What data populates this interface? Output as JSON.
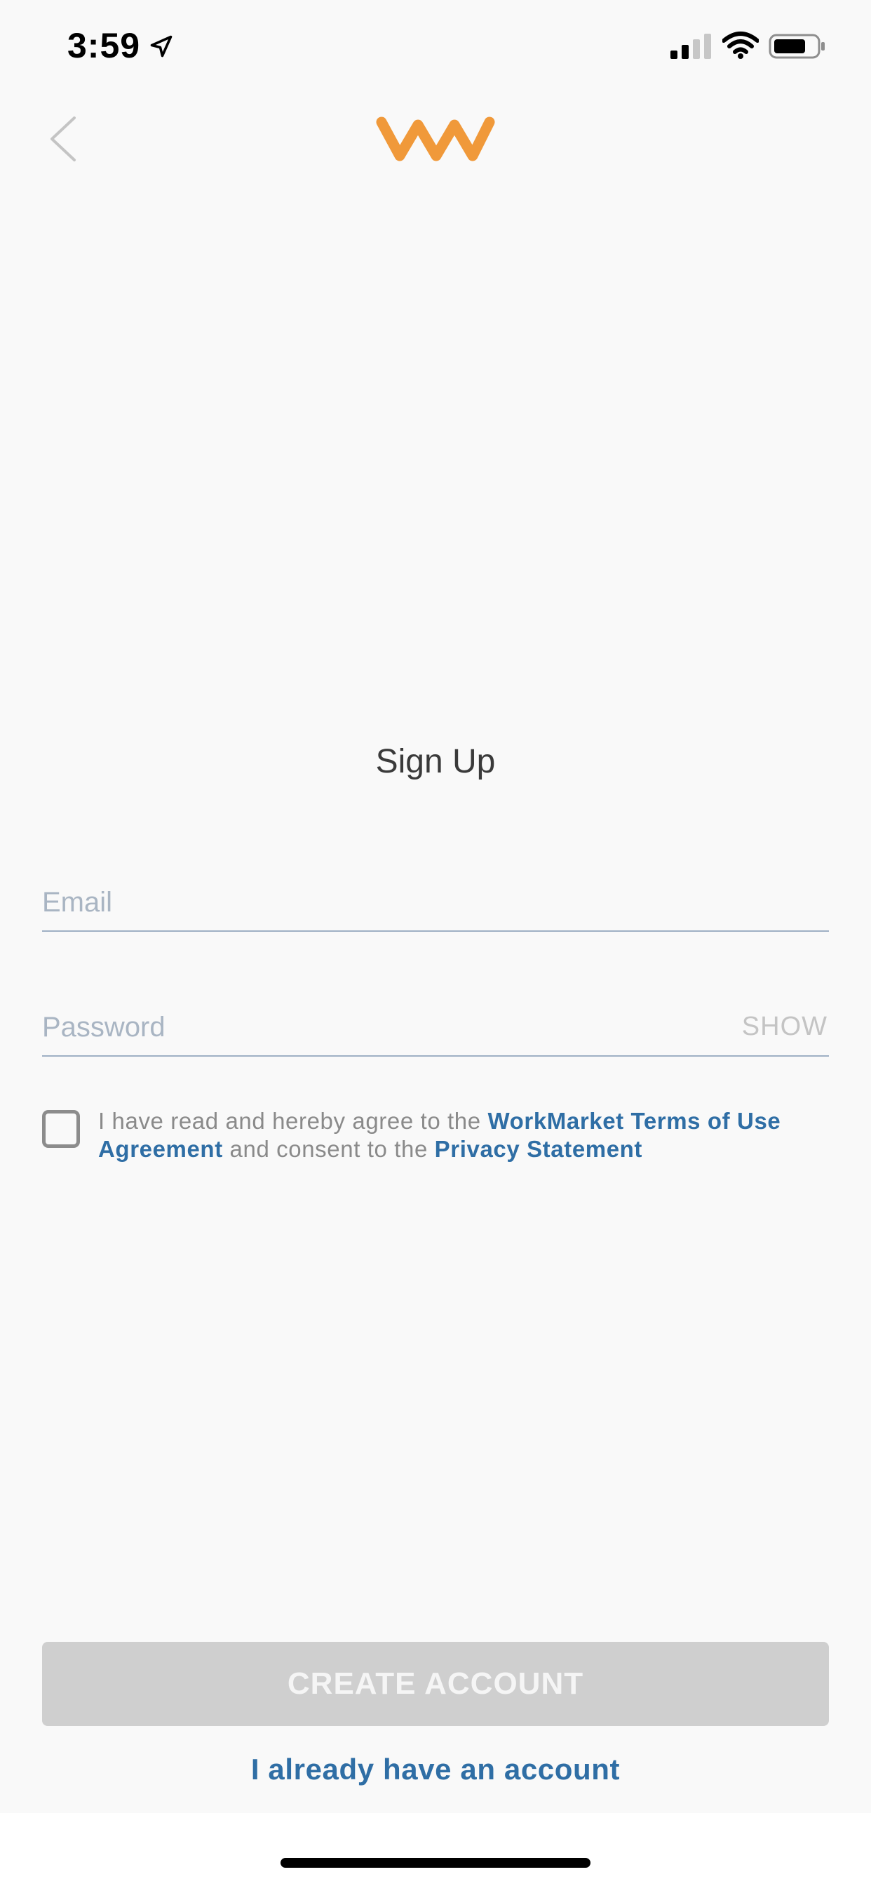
{
  "status_bar": {
    "time": "3:59",
    "icons": [
      "location-arrow-icon",
      "cellular-signal-icon",
      "wifi-icon",
      "battery-icon"
    ]
  },
  "header": {
    "back_icon": "chevron-left-icon",
    "logo": "workmarket-logo",
    "logo_color": "#f0993a"
  },
  "title": "Sign Up",
  "form": {
    "email_placeholder": "Email",
    "email_value": "",
    "password_placeholder": "Password",
    "password_value": "",
    "show_label": "SHOW",
    "agree": {
      "checked": false,
      "text_before": "I have read and hereby agree to the ",
      "terms_link": "WorkMarket Terms of Use Agreement",
      "text_middle": " and consent to the ",
      "privacy_link": "Privacy Statement"
    }
  },
  "actions": {
    "create_account": "CREATE ACCOUNT",
    "signin_link": "I already have an account"
  },
  "colors": {
    "accent": "#2f6ea5",
    "brand": "#f0993a",
    "button_disabled": "#cfcfcf",
    "background": "#f9f9f9"
  }
}
